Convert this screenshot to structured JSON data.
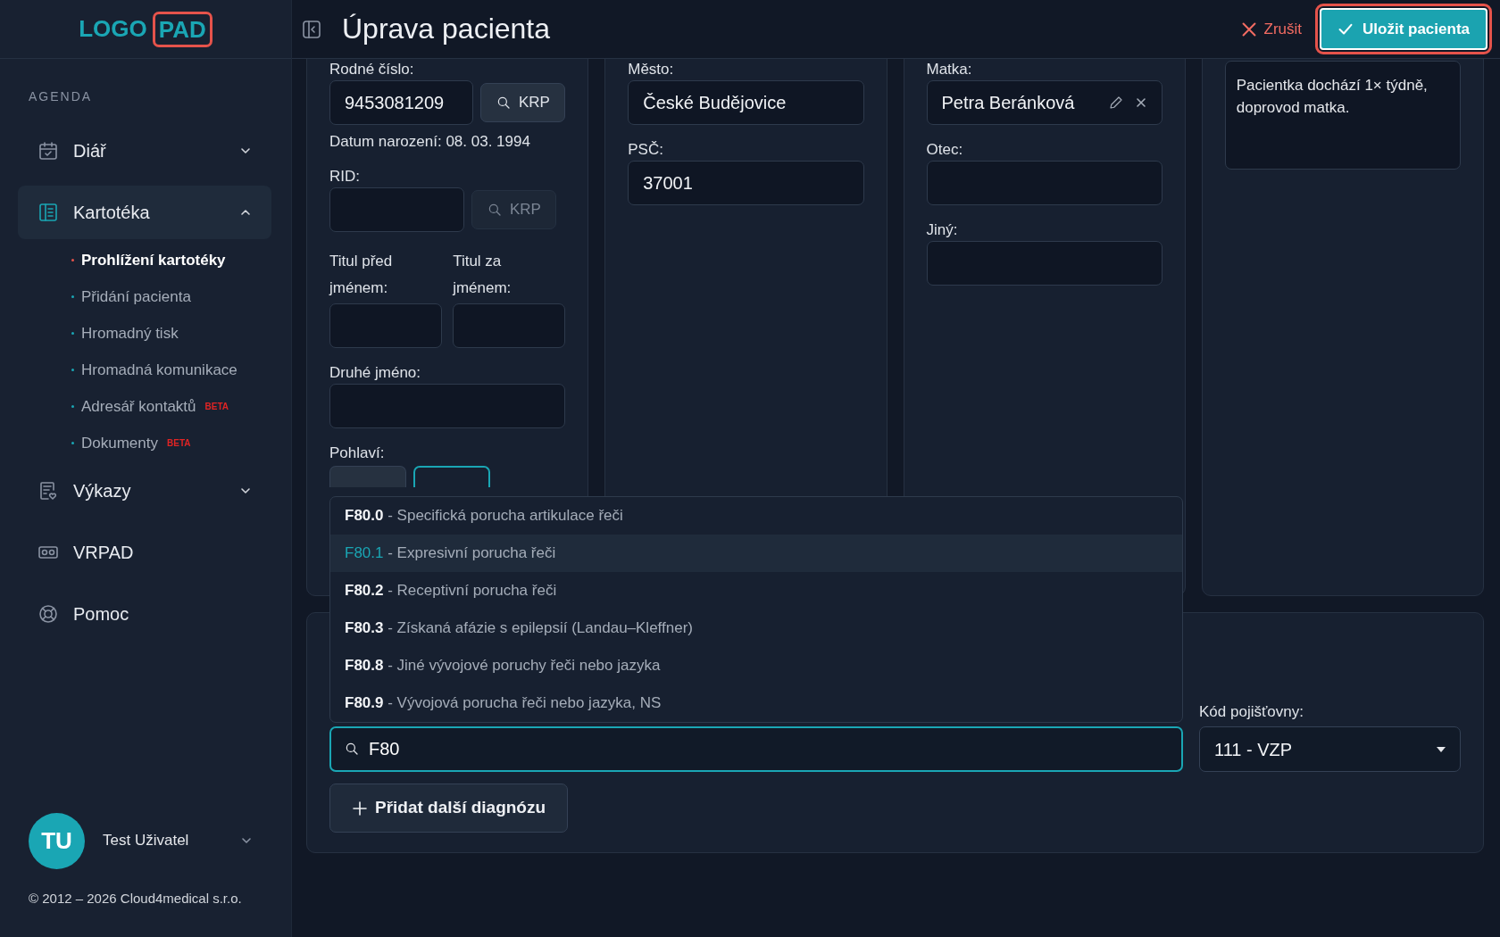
{
  "logo": {
    "text": "LOGO",
    "boxed": "PAD"
  },
  "sidebar": {
    "section": "AGENDA",
    "items": [
      {
        "kind": "group",
        "label": "Diář",
        "expanded": false,
        "selected": false
      },
      {
        "kind": "group",
        "label": "Kartotéka",
        "expanded": true,
        "selected": true,
        "children": [
          {
            "label": "Prohlížení kartotéky",
            "selected": true
          },
          {
            "label": "Přidání pacienta",
            "selected": false
          },
          {
            "label": "Hromadný tisk",
            "selected": false
          },
          {
            "label": "Hromadná komunikace",
            "selected": false
          },
          {
            "label": "Adresář kontaktů",
            "badge": "BETA",
            "selected": false
          },
          {
            "label": "Dokumenty",
            "badge": "BETA",
            "selected": false
          }
        ]
      },
      {
        "kind": "group",
        "label": "Výkazy",
        "expanded": false,
        "selected": false
      },
      {
        "kind": "link",
        "label": "VRPAD",
        "selected": false
      },
      {
        "kind": "link",
        "label": "Pomoc",
        "selected": false
      }
    ]
  },
  "user": {
    "initials": "TU",
    "name": "Test Uživatel"
  },
  "copyright": "© 2012 – 2026 Cloud4medical s.r.o.",
  "header": {
    "title": "Úprava pacienta",
    "cancel": "Zrušit",
    "save": "Uložit pacienta",
    "save_highlighted": true
  },
  "identity": {
    "birth_number": {
      "label": "Rodné číslo:",
      "value": "9453081209",
      "button": "KRP",
      "disabled": false
    },
    "birth_date": "Datum narození: 08. 03. 1994",
    "rid": {
      "label": "RID:",
      "button": "KRP",
      "disabled": true
    },
    "title_before": {
      "label": "Titul před jménem:"
    },
    "title_after": {
      "label": "Titul za jménem:"
    },
    "middle_name": {
      "label": "Druhé jméno:"
    },
    "gender": {
      "label": "Pohlaví:",
      "options": [
        {
          "selected": false
        },
        {
          "selected": true
        }
      ]
    }
  },
  "address": {
    "city": {
      "label": "Město:",
      "value": "České Budějovice"
    },
    "zip": {
      "label": "PSČ:",
      "value": "37001"
    }
  },
  "parents": {
    "mother": {
      "label": "Matka:",
      "value": "Petra Beránková"
    },
    "father": {
      "label": "Otec:"
    },
    "other": {
      "label": "Jiný:"
    }
  },
  "notes": {
    "value": "Pacientka dochází 1× týdně, doprovod matka."
  },
  "diagnosis": {
    "suggestions": [
      {
        "text": "**F80.0** - Specifická porucha artikulace řeči",
        "selected": false
      },
      {
        "text": "**F80.1** - Expresivní porucha řeči",
        "selected": true
      },
      {
        "text": "**F80.2** - Receptivní porucha řeči",
        "selected": false
      },
      {
        "text": "**F80.3** - Získaná afázie s epilepsií (Landau–Kleffner)",
        "selected": false
      },
      {
        "text": "**F80.8** - Jiné vývojové poruchy řeči nebo jazyka",
        "selected": false
      },
      {
        "text": "**F80.9** - Vývojová porucha řeči nebo jazyka, NS",
        "selected": false
      }
    ],
    "search": {
      "value": "F80"
    },
    "add_button": "Přidat další diagnózu",
    "insurance": {
      "label": "Kód pojišťovny:",
      "value": "111 - VZP"
    }
  }
}
